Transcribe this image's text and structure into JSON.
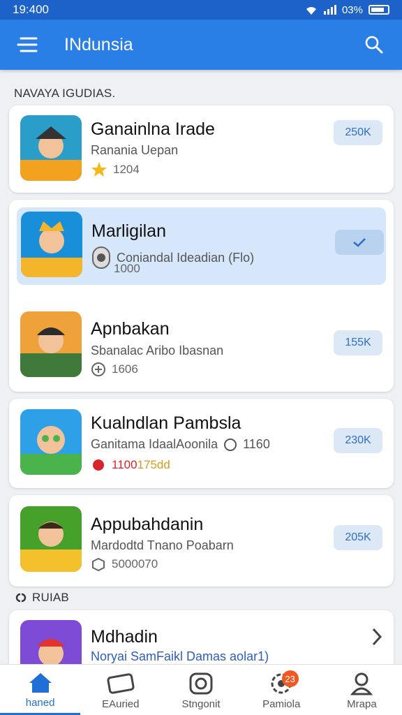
{
  "status_bar": {
    "time": "19:400",
    "battery": "03%"
  },
  "app_bar": {
    "title": "INdunsia"
  },
  "sections": {
    "top": "NAVAYA IGUDIAS.",
    "bottom": "RUIAB"
  },
  "apps": [
    {
      "name": "Ganainlna Irade",
      "subtitle": "Ranania Uepan",
      "meta": "1204",
      "meta_icon": "star-icon",
      "action": "250K",
      "colors": [
        "#2a9ec9",
        "#f3a21f"
      ]
    },
    {
      "name": "Marligilan",
      "subtitle": "Coniandal Ideadian (Flo)",
      "meta": "1000",
      "meta_icon": "camera-icon",
      "action": "check",
      "selected": true,
      "colors": [
        "#1a8fd9",
        "#f5b52a"
      ]
    },
    {
      "name": "Apnbakan",
      "subtitle": "Sbanalac Aribo Ibasnan",
      "meta": "1606",
      "meta_icon": "leaf-icon",
      "action": "155K",
      "colors": [
        "#f0a23a",
        "#3f7a3a"
      ]
    },
    {
      "name": "Kualndlan Pambsla",
      "subtitle": "Ganitama IdaalAoonila",
      "subtitle_extra": "1160",
      "meta": "1100",
      "meta_extra": "175dd",
      "meta_icon": "flower-icon",
      "action": "230K",
      "colors": [
        "#2ea0e8",
        "#4bb34b"
      ]
    },
    {
      "name": "Appubahdanin",
      "subtitle": "Mardodtd Tnano Poabarn",
      "meta": "5000070",
      "meta_icon": "box-icon",
      "action": "205K",
      "colors": [
        "#46a12b",
        "#f4c12c"
      ]
    },
    {
      "name": "Mdhadin",
      "subtitle": "Noryai SamFaikl Damas aolar1)",
      "action": "chevron",
      "colors": [
        "#7d4bd6",
        "#e2332f"
      ]
    }
  ],
  "bottom_nav": [
    {
      "label": "haned",
      "icon": "home-icon",
      "active": true
    },
    {
      "label": "EAuried",
      "icon": "ticket-icon"
    },
    {
      "label": "Stngonit",
      "icon": "camera-icon"
    },
    {
      "label": "Pamiola",
      "icon": "settings-icon",
      "badge": "23"
    },
    {
      "label": "Mrapa",
      "icon": "person-icon"
    }
  ],
  "colors": {
    "primary": "#2a7fe6",
    "status_bar": "#1d62c8",
    "accent": "#1f6fd6",
    "badge": "#f05a22"
  }
}
